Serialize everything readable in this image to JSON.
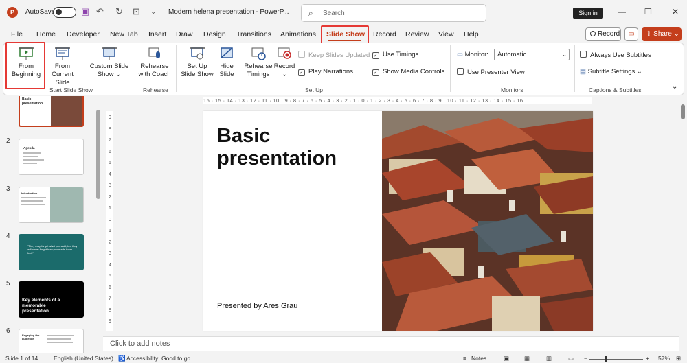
{
  "titlebar": {
    "app_icon": "powerpoint-icon",
    "autosave_label": "AutoSave",
    "autosave_state": "Off",
    "doc_title": "Modern helena presentation  -  PowerP...",
    "search_placeholder": "Search",
    "signin_label": "Sign in"
  },
  "tabs": [
    "File",
    "Home",
    "Developer",
    "New Tab",
    "Insert",
    "Draw",
    "Design",
    "Transitions",
    "Animations",
    "Slide Show",
    "Record",
    "Review",
    "View",
    "Help"
  ],
  "active_tab": "Slide Show",
  "actions": {
    "record_label": "Record",
    "share_label": "Share"
  },
  "ribbon": {
    "start_group": {
      "label": "Start Slide Show",
      "from_beginning": "From Beginning",
      "from_current": "From Current Slide",
      "custom": "Custom Slide Show"
    },
    "rehearse_group": {
      "label": "Rehearse",
      "rehearse_coach": "Rehearse with Coach"
    },
    "setup_group": {
      "label": "Set Up",
      "setup_show": "Set Up Slide Show",
      "hide_slide": "Hide Slide",
      "rehearse_timings": "Rehearse Timings",
      "record": "Record",
      "keep_updated": "Keep Slides Updated",
      "play_narrations": "Play Narrations",
      "use_timings": "Use Timings",
      "show_media_controls": "Show Media Controls"
    },
    "monitors_group": {
      "label": "Monitors",
      "monitor_label": "Monitor:",
      "monitor_value": "Automatic",
      "presenter_view": "Use Presenter View"
    },
    "captions_group": {
      "label": "Captions & Subtitles",
      "always_subtitles": "Always Use Subtitles",
      "subtitle_settings": "Subtitle Settings"
    }
  },
  "thumbnails": [
    {
      "num": "",
      "title": "Basic presentation",
      "theme": "dark-photo"
    },
    {
      "num": "2",
      "title": "Agenda",
      "theme": "white"
    },
    {
      "num": "3",
      "title": "Introduction",
      "theme": "white-photo"
    },
    {
      "num": "4",
      "title": "\"They may forget what you said, but they will never forget how you made them feel.\"",
      "theme": "teal"
    },
    {
      "num": "5",
      "title": "Key elements of a memorable presentation",
      "theme": "black"
    },
    {
      "num": "6",
      "title": "Engaging the audience",
      "theme": "white"
    }
  ],
  "slide": {
    "title": "Basic\npresentation",
    "subtitle": "Presented by Ares Grau"
  },
  "ruler_h": "16 · 15 · 14 · 13 · 12 · 11 · 10 · 9 · 8 · 7 · 6 · 5 · 4 · 3 · 2 · 1 · 0 · 1 · 2 · 3 · 4 · 5 · 6 · 7 · 8 · 9 · 10 · 11 · 12 · 13 · 14 · 15 · 16",
  "notes_placeholder": "Click to add notes",
  "status": {
    "slide_count": "Slide 1 of 14",
    "language": "English (United States)",
    "accessibility": "Accessibility: Good to go",
    "notes": "Notes",
    "zoom": "57%"
  },
  "colors": {
    "accent": "#c43e1c",
    "highlight": "#e53935",
    "teal": "#1b6b6b"
  }
}
